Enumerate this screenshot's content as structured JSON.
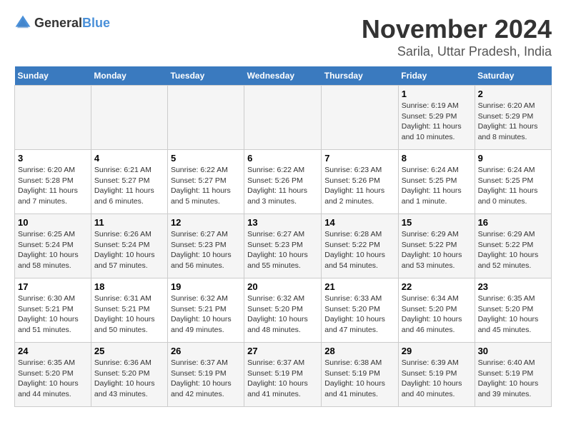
{
  "header": {
    "logo_general": "General",
    "logo_blue": "Blue",
    "month": "November 2024",
    "location": "Sarila, Uttar Pradesh, India"
  },
  "weekdays": [
    "Sunday",
    "Monday",
    "Tuesday",
    "Wednesday",
    "Thursday",
    "Friday",
    "Saturday"
  ],
  "weeks": [
    [
      {
        "day": "",
        "info": ""
      },
      {
        "day": "",
        "info": ""
      },
      {
        "day": "",
        "info": ""
      },
      {
        "day": "",
        "info": ""
      },
      {
        "day": "",
        "info": ""
      },
      {
        "day": "1",
        "info": "Sunrise: 6:19 AM\nSunset: 5:29 PM\nDaylight: 11 hours and 10 minutes."
      },
      {
        "day": "2",
        "info": "Sunrise: 6:20 AM\nSunset: 5:29 PM\nDaylight: 11 hours and 8 minutes."
      }
    ],
    [
      {
        "day": "3",
        "info": "Sunrise: 6:20 AM\nSunset: 5:28 PM\nDaylight: 11 hours and 7 minutes."
      },
      {
        "day": "4",
        "info": "Sunrise: 6:21 AM\nSunset: 5:27 PM\nDaylight: 11 hours and 6 minutes."
      },
      {
        "day": "5",
        "info": "Sunrise: 6:22 AM\nSunset: 5:27 PM\nDaylight: 11 hours and 5 minutes."
      },
      {
        "day": "6",
        "info": "Sunrise: 6:22 AM\nSunset: 5:26 PM\nDaylight: 11 hours and 3 minutes."
      },
      {
        "day": "7",
        "info": "Sunrise: 6:23 AM\nSunset: 5:26 PM\nDaylight: 11 hours and 2 minutes."
      },
      {
        "day": "8",
        "info": "Sunrise: 6:24 AM\nSunset: 5:25 PM\nDaylight: 11 hours and 1 minute."
      },
      {
        "day": "9",
        "info": "Sunrise: 6:24 AM\nSunset: 5:25 PM\nDaylight: 11 hours and 0 minutes."
      }
    ],
    [
      {
        "day": "10",
        "info": "Sunrise: 6:25 AM\nSunset: 5:24 PM\nDaylight: 10 hours and 58 minutes."
      },
      {
        "day": "11",
        "info": "Sunrise: 6:26 AM\nSunset: 5:24 PM\nDaylight: 10 hours and 57 minutes."
      },
      {
        "day": "12",
        "info": "Sunrise: 6:27 AM\nSunset: 5:23 PM\nDaylight: 10 hours and 56 minutes."
      },
      {
        "day": "13",
        "info": "Sunrise: 6:27 AM\nSunset: 5:23 PM\nDaylight: 10 hours and 55 minutes."
      },
      {
        "day": "14",
        "info": "Sunrise: 6:28 AM\nSunset: 5:22 PM\nDaylight: 10 hours and 54 minutes."
      },
      {
        "day": "15",
        "info": "Sunrise: 6:29 AM\nSunset: 5:22 PM\nDaylight: 10 hours and 53 minutes."
      },
      {
        "day": "16",
        "info": "Sunrise: 6:29 AM\nSunset: 5:22 PM\nDaylight: 10 hours and 52 minutes."
      }
    ],
    [
      {
        "day": "17",
        "info": "Sunrise: 6:30 AM\nSunset: 5:21 PM\nDaylight: 10 hours and 51 minutes."
      },
      {
        "day": "18",
        "info": "Sunrise: 6:31 AM\nSunset: 5:21 PM\nDaylight: 10 hours and 50 minutes."
      },
      {
        "day": "19",
        "info": "Sunrise: 6:32 AM\nSunset: 5:21 PM\nDaylight: 10 hours and 49 minutes."
      },
      {
        "day": "20",
        "info": "Sunrise: 6:32 AM\nSunset: 5:20 PM\nDaylight: 10 hours and 48 minutes."
      },
      {
        "day": "21",
        "info": "Sunrise: 6:33 AM\nSunset: 5:20 PM\nDaylight: 10 hours and 47 minutes."
      },
      {
        "day": "22",
        "info": "Sunrise: 6:34 AM\nSunset: 5:20 PM\nDaylight: 10 hours and 46 minutes."
      },
      {
        "day": "23",
        "info": "Sunrise: 6:35 AM\nSunset: 5:20 PM\nDaylight: 10 hours and 45 minutes."
      }
    ],
    [
      {
        "day": "24",
        "info": "Sunrise: 6:35 AM\nSunset: 5:20 PM\nDaylight: 10 hours and 44 minutes."
      },
      {
        "day": "25",
        "info": "Sunrise: 6:36 AM\nSunset: 5:20 PM\nDaylight: 10 hours and 43 minutes."
      },
      {
        "day": "26",
        "info": "Sunrise: 6:37 AM\nSunset: 5:19 PM\nDaylight: 10 hours and 42 minutes."
      },
      {
        "day": "27",
        "info": "Sunrise: 6:37 AM\nSunset: 5:19 PM\nDaylight: 10 hours and 41 minutes."
      },
      {
        "day": "28",
        "info": "Sunrise: 6:38 AM\nSunset: 5:19 PM\nDaylight: 10 hours and 41 minutes."
      },
      {
        "day": "29",
        "info": "Sunrise: 6:39 AM\nSunset: 5:19 PM\nDaylight: 10 hours and 40 minutes."
      },
      {
        "day": "30",
        "info": "Sunrise: 6:40 AM\nSunset: 5:19 PM\nDaylight: 10 hours and 39 minutes."
      }
    ]
  ]
}
